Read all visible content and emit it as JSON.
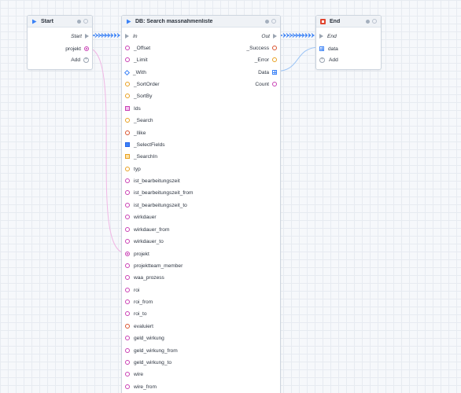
{
  "colors": {
    "canvas": "#f6f8fb",
    "exec_wire": "#3b82f6",
    "data_wire_pink": "#f0b8e4",
    "data_wire_blue": "#9cc4f5",
    "param_pink": "#c940b4",
    "param_orange": "#e8a020",
    "start_accent": "#3b82f6",
    "end_accent": "#e0452f"
  },
  "start_node": {
    "title": "Start",
    "icon": "play-icon",
    "out_exec_label": "Start",
    "params": [
      "projekt"
    ],
    "add_label": "Add"
  },
  "db_node": {
    "title": "DB: Search massnahmenliste",
    "icon": "database-icon",
    "in_exec_label": "In",
    "out_exec_label": "Out",
    "outputs": [
      {
        "label": "_Success",
        "pin": "circle-red"
      },
      {
        "label": "_Error",
        "pin": "circle-orange"
      },
      {
        "label": "Data",
        "pin": "grid-blue"
      },
      {
        "label": "Count",
        "pin": "circle-pink"
      }
    ],
    "inputs": [
      {
        "label": "_Offset",
        "pin": "circle-pink"
      },
      {
        "label": "_Limit",
        "pin": "circle-pink"
      },
      {
        "label": "_With",
        "pin": "diamond-blue"
      },
      {
        "label": "_SortOrder",
        "pin": "circle-orange"
      },
      {
        "label": "_SortBy",
        "pin": "circle-orange"
      },
      {
        "label": "Ids",
        "pin": "square-pink"
      },
      {
        "label": "_Search",
        "pin": "circle-orange"
      },
      {
        "label": "_Ilike",
        "pin": "circle-red"
      },
      {
        "label": "_SelectFields",
        "pin": "square-blue"
      },
      {
        "label": "_SearchIn",
        "pin": "square-orange"
      },
      {
        "label": "typ",
        "pin": "circle-orange"
      },
      {
        "label": "ist_bearbeitungszeit",
        "pin": "circle-pink"
      },
      {
        "label": "ist_bearbeitungszeit_from",
        "pin": "circle-pink"
      },
      {
        "label": "ist_bearbeitungszeit_to",
        "pin": "circle-pink"
      },
      {
        "label": "wirkdauer",
        "pin": "circle-pink"
      },
      {
        "label": "wirkdauer_from",
        "pin": "circle-pink"
      },
      {
        "label": "wirkdauer_to",
        "pin": "circle-pink"
      },
      {
        "label": "projekt",
        "pin": "circle-pink-filled"
      },
      {
        "label": "projektteam_member",
        "pin": "circle-pink"
      },
      {
        "label": "waa_prozess",
        "pin": "circle-pink"
      },
      {
        "label": "roi",
        "pin": "circle-pink"
      },
      {
        "label": "roi_from",
        "pin": "circle-pink"
      },
      {
        "label": "roi_to",
        "pin": "circle-pink"
      },
      {
        "label": "evaluiert",
        "pin": "circle-red"
      },
      {
        "label": "geld_wirkung",
        "pin": "circle-pink"
      },
      {
        "label": "geld_wirkung_from",
        "pin": "circle-pink"
      },
      {
        "label": "geld_wirkung_to",
        "pin": "circle-pink"
      },
      {
        "label": "wire",
        "pin": "circle-pink"
      },
      {
        "label": "wire_from",
        "pin": "circle-pink"
      }
    ]
  },
  "end_node": {
    "title": "End",
    "icon": "stop-icon",
    "in_exec_label": "End",
    "params": [
      "data"
    ],
    "add_label": "Add"
  }
}
